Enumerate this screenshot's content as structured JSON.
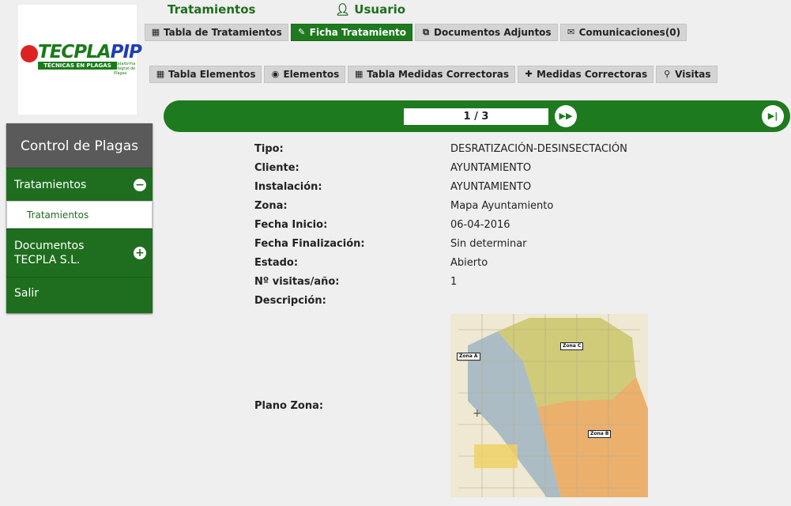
{
  "logo": {
    "brand": "TECPLA",
    "brand_accent": "PIP",
    "tagline": "TÉCNICAS EN PLAGAS",
    "slogan": "Plataforma Integral de Plagas"
  },
  "header": {
    "title": "Tratamientos",
    "user": "Usuario",
    "user_icon": "user-icon"
  },
  "tabs_top": [
    {
      "label": "Tabla de Tratamientos",
      "icon": "table-icon"
    },
    {
      "label": "Ficha Tratamiento",
      "icon": "pencil-icon",
      "active": true
    },
    {
      "label": "Documentos Adjuntos",
      "icon": "copy-icon"
    },
    {
      "label": "Comunicaciones(0)",
      "icon": "comments-icon"
    }
  ],
  "tabs_sub": [
    {
      "label": "Tabla Elementos",
      "icon": "table-icon"
    },
    {
      "label": "Elementos",
      "icon": "circle-icon"
    },
    {
      "label": "Tabla Medidas Correctoras",
      "icon": "table-icon"
    },
    {
      "label": "Medidas Correctoras",
      "icon": "medkit-icon"
    },
    {
      "label": "Visitas",
      "icon": "map-marker-icon"
    }
  ],
  "pager": {
    "text": "1 / 3",
    "next_icon": "fast-forward-icon",
    "last_icon": "step-forward-icon"
  },
  "sidebar": {
    "title": "Control de Plagas",
    "items": [
      {
        "label": "Tratamientos",
        "toggle": "−"
      },
      {
        "label": "Tratamientos"
      },
      {
        "label": "Documentos TECPLA S.L.",
        "toggle": "+"
      },
      {
        "label": "Salir"
      }
    ]
  },
  "details": [
    {
      "label": "Tipo:",
      "value": "DESRATIZACIÓN-DESINSECTACIÓN"
    },
    {
      "label": "Cliente:",
      "value": "AYUNTAMIENTO"
    },
    {
      "label": "Instalación:",
      "value": "AYUNTAMIENTO"
    },
    {
      "label": "Zona:",
      "value": "Mapa Ayuntamiento"
    },
    {
      "label": "Fecha Inicio:",
      "value": "06-04-2016"
    },
    {
      "label": "Fecha Finalización:",
      "value": "Sin determinar"
    },
    {
      "label": "Estado:",
      "value": "Abierto"
    },
    {
      "label": "Nº visitas/año:",
      "value": "1"
    },
    {
      "label": "Descripción:",
      "value": ""
    },
    {
      "label": "Plano Zona:",
      "value": ""
    }
  ],
  "map_zones": [
    "Zona A",
    "Zona C",
    "Zona B"
  ],
  "colors": {
    "green": "#1f7a1f",
    "sidebar_title": "#5a5a5a",
    "tab_grey": "#d4d4d4"
  }
}
